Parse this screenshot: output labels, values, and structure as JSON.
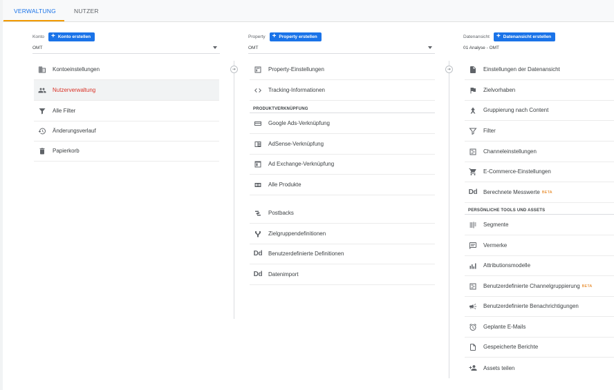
{
  "tabs": [
    {
      "label": "VERWALTUNG"
    },
    {
      "label": "NUTZER"
    }
  ],
  "konto": {
    "label": "Konto",
    "create_label": "Konto erstellen",
    "selected": "OMT",
    "items": [
      {
        "label": "Kontoeinstellungen",
        "icon": "building-icon"
      },
      {
        "label": "Nutzerverwaltung",
        "icon": "people-icon"
      },
      {
        "label": "Alle Filter",
        "icon": "filter-icon"
      },
      {
        "label": "Änderungsverlauf",
        "icon": "history-icon"
      },
      {
        "label": "Papierkorb",
        "icon": "trash-icon"
      }
    ]
  },
  "property": {
    "label": "Property",
    "create_label": "Property erstellen",
    "selected": "OMT",
    "items": [
      {
        "label": "Property-Einstellungen",
        "icon": "window-icon"
      },
      {
        "label": "Tracking-Informationen",
        "icon": "code-icon"
      }
    ],
    "section_title": "PRODUKTVERKNÜPFUNG",
    "linking_items": [
      {
        "label": "Google Ads-Verknüpfung",
        "icon": "ads-icon"
      },
      {
        "label": "AdSense-Verknüpfung",
        "icon": "adsense-icon"
      },
      {
        "label": "Ad Exchange-Verknüpfung",
        "icon": "adexchange-icon"
      },
      {
        "label": "Alle Produkte",
        "icon": "link-icon"
      }
    ],
    "other_items": [
      {
        "label": "Postbacks",
        "icon": "postbacks-icon"
      },
      {
        "label": "Zielgruppendefinitionen",
        "icon": "audience-icon"
      },
      {
        "label": "Benutzerdefinierte Definitionen",
        "icon": "dd-icon"
      },
      {
        "label": "Datenimport",
        "icon": "dd-icon"
      }
    ]
  },
  "view": {
    "label": "Datenansicht",
    "create_label": "Datenansicht erstellen",
    "selected": "01 Analyse - OMT",
    "items": [
      {
        "label": "Einstellungen der Datenansicht",
        "icon": "document-icon"
      },
      {
        "label": "Zielvorhaben",
        "icon": "flag-icon"
      },
      {
        "label": "Gruppierung nach Content",
        "icon": "grouping-icon"
      },
      {
        "label": "Filter",
        "icon": "filter-icon"
      },
      {
        "label": "Channeleinstellungen",
        "icon": "channel-icon"
      },
      {
        "label": "E-Commerce-Einstellungen",
        "icon": "cart-icon"
      },
      {
        "label": "Berechnete Messwerte",
        "icon": "dd-icon",
        "badge": "BETA"
      }
    ],
    "section_title": "PERSÖNLICHE TOOLS UND ASSETS",
    "tools": [
      {
        "label": "Segmente",
        "icon": "segments-icon"
      },
      {
        "label": "Vermerke",
        "icon": "comment-icon"
      },
      {
        "label": "Attributionsmodelle",
        "icon": "bar-chart-icon"
      },
      {
        "label": "Benutzerdefinierte Channelgruppierung",
        "icon": "channel-icon",
        "badge": "BETA"
      },
      {
        "label": "Benutzerdefinierte Benachrichtigungen",
        "icon": "megaphone-icon"
      },
      {
        "label": "Geplante E-Mails",
        "icon": "alarm-icon"
      },
      {
        "label": "Gespeicherte Berichte",
        "icon": "saved-report-icon"
      },
      {
        "label": "Assets teilen",
        "icon": "person-add-icon"
      }
    ]
  },
  "colors": {
    "accent": "#1a73e8",
    "active_text": "#d93025",
    "tab_underline": "#f29900",
    "beta": "#e37400"
  }
}
